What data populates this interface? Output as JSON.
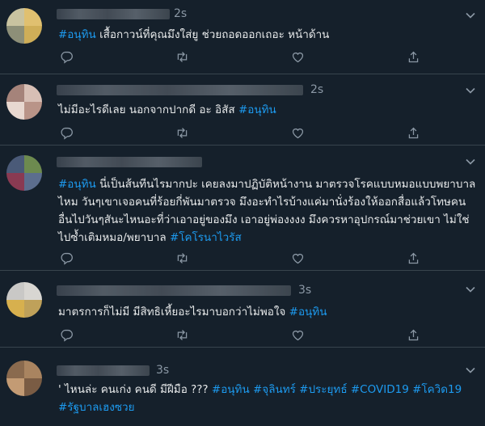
{
  "tweets": [
    {
      "time": "2s",
      "segments": [
        {
          "t": "#อนุทิน",
          "h": true
        },
        {
          "t": " เสื้อกาวน์ที่คุณมึงใส่ยู ช่วยถอดออกเถอะ หน้าด้าน",
          "h": false
        }
      ]
    },
    {
      "time": "2s",
      "segments": [
        {
          "t": "ไม่มีอะไรดีเลย นอกจากปากดี อะ อิสัส ",
          "h": false
        },
        {
          "t": "#อนุทิน",
          "h": true
        }
      ]
    },
    {
      "time": "",
      "segments": [
        {
          "t": "#อนุทิน",
          "h": true
        },
        {
          "t": " นี่เป็นส้นทีนไรมากปะ เคยลงมาปฏิบัติหน้างาน มาตรวจโรคแบบหมอแบบพยาบาลไหม วันๆเขาเจอคนที่ร้อยกี่พันมาตรวจ มึงอะทำไรบ้างแค่มานั่งร้องให้ออกสื่อแล้วโทษคนอื่นไปวันๆสันะไหนอะที่ว่าเอาอยู่ของมึง เอาอยู่พ่องงงง มึงควรหาอุปกรณ์มาช่วยเขา ไม่ใช่ไปซ้ำเติมหมอ/พยาบาล ",
          "h": false
        },
        {
          "t": "#โคโรนาไวรัส",
          "h": true
        }
      ]
    },
    {
      "time": "3s",
      "segments": [
        {
          "t": "มาตรการก็ไม่มี มีสิทธิเหี้ยอะไรมาบอกว่าไม่พอใจ ",
          "h": false
        },
        {
          "t": "#อนุทิน",
          "h": true
        }
      ]
    },
    {
      "time": "3s",
      "segments": [
        {
          "t": "' ไหนล่ะ คนเก่ง คนดี มีฝีมือ ??? ",
          "h": false
        },
        {
          "t": "#อนุทิน",
          "h": true
        },
        {
          "t": " ",
          "h": false
        },
        {
          "t": "#จุลินทร์",
          "h": true
        },
        {
          "t": " ",
          "h": false
        },
        {
          "t": "#ประยุทธ์",
          "h": true
        },
        {
          "t": " ",
          "h": false
        },
        {
          "t": "#COVID19",
          "h": true
        },
        {
          "t": " ",
          "h": false
        },
        {
          "t": "#โควิด19",
          "h": true
        },
        {
          "t": " ",
          "h": false
        },
        {
          "t": "#รัฐบาลเฮงซวย",
          "h": true
        }
      ]
    }
  ],
  "colors": {
    "background": "#15202b",
    "text": "#e7e9ea",
    "hashtag": "#1d9bf0",
    "muted": "#8b98a5",
    "divider": "#38444d"
  },
  "icons": [
    "reply-icon",
    "retweet-icon",
    "like-icon",
    "share-icon",
    "chevron-down-icon"
  ]
}
